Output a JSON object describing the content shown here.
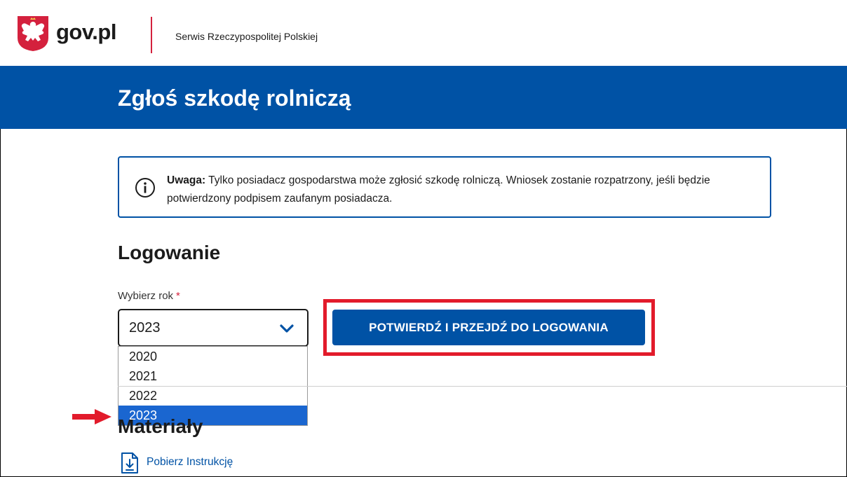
{
  "header": {
    "logo_text": "gov.pl",
    "service_name": "Serwis Rzeczypospolitej Polskiej"
  },
  "banner": {
    "title": "Zgłoś szkodę rolniczą"
  },
  "notice": {
    "label": "Uwaga:",
    "text": " Tylko posiadacz gospodarstwa może zgłosić szkodę rolniczą. Wniosek zostanie rozpatrzony, jeśli będzie potwierdzony podpisem zaufanym posiadacza."
  },
  "login": {
    "title": "Logowanie",
    "year_label": "Wybierz rok",
    "required_mark": "*",
    "selected_year": "2023",
    "year_options": [
      "2020",
      "2021",
      "2022",
      "2023"
    ],
    "confirm_button": "POTWIERDŹ I PRZEJDŹ DO LOGOWANIA"
  },
  "materials": {
    "title": "Materiały",
    "download_link": "Pobierz Instrukcję"
  },
  "colors": {
    "brand_blue": "#0052a5",
    "accent_red": "#d4213d",
    "annotation_red": "#e21b2b",
    "selected_option": "#1a66d0"
  }
}
